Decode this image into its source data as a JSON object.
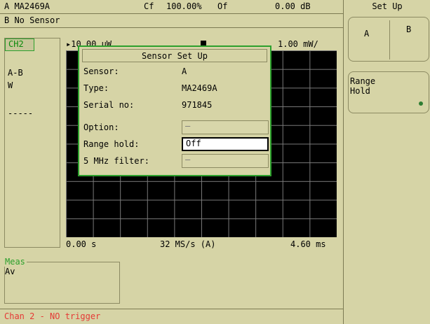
{
  "status": {
    "sensor_a": "A MA2469A",
    "cf_label": "Cf",
    "cf_value": "100.00%",
    "of_label": "Of",
    "of_value": "0.00 dB",
    "sensor_b": "B No Sensor"
  },
  "channel": {
    "label": "CH2",
    "expression": "A-B",
    "unit": "W",
    "line": "-----"
  },
  "plot": {
    "y_top_left": "▸10.00 µW",
    "y_top_right": "1.00 mW/",
    "x_left": "0.00 s",
    "x_center": "32 MS/s (A)",
    "x_right": "4.60 ms"
  },
  "meas": {
    "title": "Meas",
    "value": "Av"
  },
  "status_line": "Chan 2 - NO trigger",
  "menu": {
    "title": "Set Up",
    "tab_a": "A",
    "tab_b": "B",
    "range_hold": "Range Hold"
  },
  "dialog": {
    "title": "Sensor Set Up",
    "sensor_label": "Sensor:",
    "sensor_value": "A",
    "type_label": "Type:",
    "type_value": "MA2469A",
    "serial_label": "Serial no:",
    "serial_value": "971845",
    "option_label": "Option:",
    "option_value": "–",
    "range_label": "Range hold:",
    "range_value": "Off",
    "filter_label": "5 MHz filter:",
    "filter_value": "–"
  },
  "colors": {
    "background": "#d6d4a6",
    "accent_green": "#2ca02c",
    "alert_red": "#e53935",
    "plot_bg": "#000000",
    "grid": "#7a7a7a"
  }
}
